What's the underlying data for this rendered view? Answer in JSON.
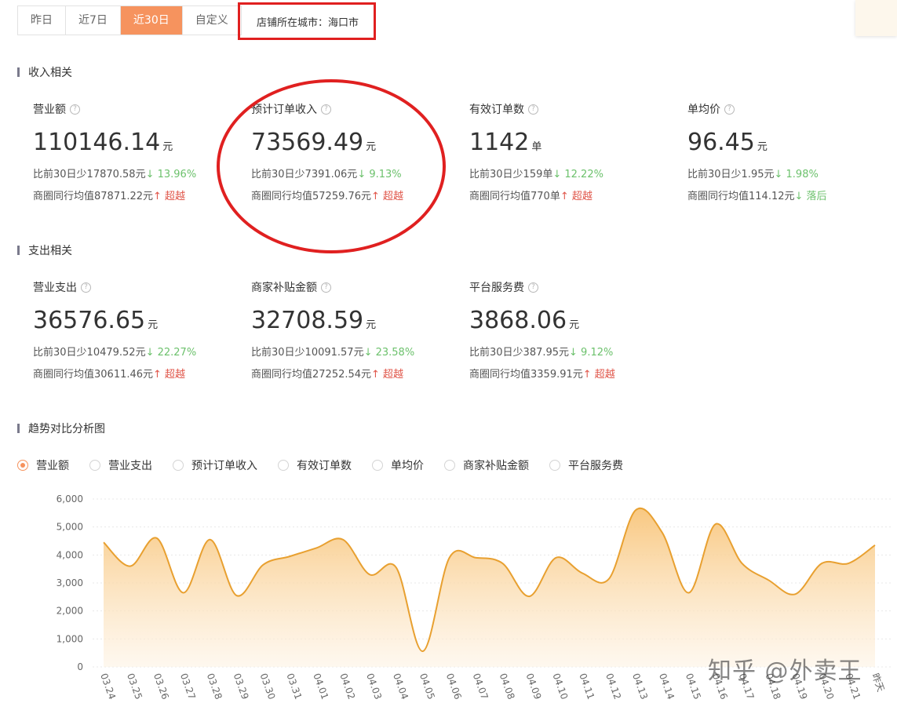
{
  "date_tabs": [
    {
      "label": "昨日",
      "active": false
    },
    {
      "label": "近7日",
      "active": false
    },
    {
      "label": "近30日",
      "active": true
    },
    {
      "label": "自定义",
      "active": false
    }
  ],
  "city_label": "店铺所在城市：海口市",
  "sections": {
    "income": "收入相关",
    "expense": "支出相关",
    "trend": "趋势对比分析图"
  },
  "income_metrics": [
    {
      "label": "营业额",
      "value": "110146.14",
      "unit": "元",
      "cmp_text": "比前30日少17870.58元",
      "cmp_pct": "↓ 13.96%",
      "avg_text": "商圈同行均值87871.22元",
      "avg_status": "↑ 超越"
    },
    {
      "label": "预计订单收入",
      "value": "73569.49",
      "unit": "元",
      "cmp_text": "比前30日少7391.06元",
      "cmp_pct": "↓ 9.13%",
      "avg_text": "商圈同行均值57259.76元",
      "avg_status": "↑ 超越"
    },
    {
      "label": "有效订单数",
      "value": "1142",
      "unit": "单",
      "cmp_text": "比前30日少159单",
      "cmp_pct": "↓ 12.22%",
      "avg_text": "商圈同行均值770单",
      "avg_status": "↑ 超越"
    },
    {
      "label": "单均价",
      "value": "96.45",
      "unit": "元",
      "cmp_text": "比前30日少1.95元",
      "cmp_pct": "↓ 1.98%",
      "avg_text": "商圈同行均值114.12元",
      "avg_status": "↓ 落后"
    }
  ],
  "expense_metrics": [
    {
      "label": "营业支出",
      "value": "36576.65",
      "unit": "元",
      "cmp_text": "比前30日少10479.52元",
      "cmp_pct": "↓ 22.27%",
      "avg_text": "商圈同行均值30611.46元",
      "avg_status": "↑ 超越"
    },
    {
      "label": "商家补贴金额",
      "value": "32708.59",
      "unit": "元",
      "cmp_text": "比前30日少10091.57元",
      "cmp_pct": "↓ 23.58%",
      "avg_text": "商圈同行均值27252.54元",
      "avg_status": "↑ 超越"
    },
    {
      "label": "平台服务费",
      "value": "3868.06",
      "unit": "元",
      "cmp_text": "比前30日少387.95元",
      "cmp_pct": "↓ 9.12%",
      "avg_text": "商圈同行均值3359.91元",
      "avg_status": "↑ 超越"
    }
  ],
  "trend_options": [
    {
      "label": "营业额",
      "selected": true
    },
    {
      "label": "营业支出",
      "selected": false
    },
    {
      "label": "预计订单收入",
      "selected": false
    },
    {
      "label": "有效订单数",
      "selected": false
    },
    {
      "label": "单均价",
      "selected": false
    },
    {
      "label": "商家补贴金额",
      "selected": false
    },
    {
      "label": "平台服务费",
      "selected": false
    }
  ],
  "chart_data": {
    "type": "area",
    "x": [
      "03.24",
      "03.25",
      "03.26",
      "03.27",
      "03.28",
      "03.29",
      "03.30",
      "03.31",
      "04.01",
      "04.02",
      "04.03",
      "04.04",
      "04.05",
      "04.06",
      "04.07",
      "04.08",
      "04.09",
      "04.10",
      "04.11",
      "04.12",
      "04.13",
      "04.14",
      "04.15",
      "04.16",
      "04.17",
      "04.18",
      "04.19",
      "04.20",
      "04.21",
      "昨天"
    ],
    "series": [
      {
        "values": [
          4450,
          3600,
          4600,
          2650,
          4550,
          2550,
          3650,
          3950,
          4250,
          4550,
          3300,
          3550,
          560,
          3900,
          3900,
          3700,
          2520,
          3900,
          3350,
          3150,
          5600,
          4800,
          2650,
          5100,
          3700,
          3100,
          2600,
          3700,
          3700,
          4350
        ]
      }
    ],
    "yticks": [
      "6,000",
      "5,000",
      "4,000",
      "3,000",
      "2,000",
      "1,000",
      "0"
    ],
    "ylim": [
      0,
      6000
    ],
    "line_color": "#e8a030",
    "fill_color_top": "#f8c57a",
    "fill_color_bottom": "#fef3e4",
    "grid": true
  },
  "watermark": "知乎 @外卖王",
  "colors": {
    "accent": "#f6935e",
    "highlight_red": "#e02020",
    "up_red": "#e0564a",
    "down_green": "#6cc16c"
  }
}
